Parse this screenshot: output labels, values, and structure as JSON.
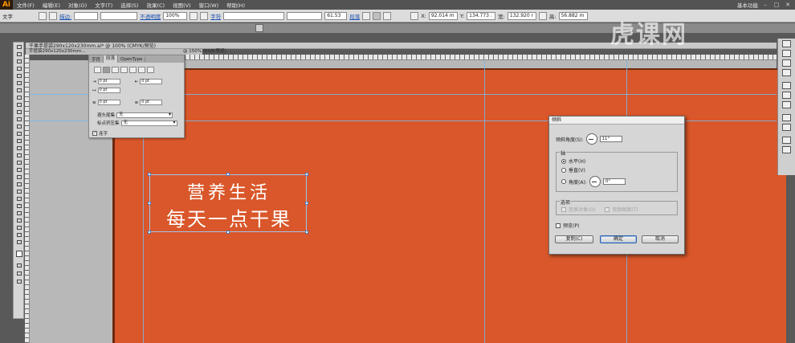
{
  "menubar": {
    "logo": "Ai",
    "items": [
      "文件(F)",
      "编辑(E)",
      "对象(O)",
      "文字(T)",
      "选择(S)",
      "效果(C)",
      "视图(V)",
      "窗口(W)",
      "帮助(H)"
    ],
    "workspace": "基本功能",
    "window_buttons": [
      "–",
      "□",
      "✕"
    ]
  },
  "controlbar": {
    "tool_label": "文字",
    "stroke_label": "描边:",
    "opacity_label": "不透明度",
    "opacity_value": "100%",
    "font_link": "字符",
    "font_size": "61.53",
    "paragraph_link": "段落",
    "x_label": "X:",
    "x_value": "92.014 m",
    "y_label": "Y:",
    "y_value": "134.773 :",
    "w_label": "宽:",
    "w_value": "132.920 r",
    "h_label": "高:",
    "h_value": "56.882 m"
  },
  "doc": {
    "tab1": "干果手提袋290x120x230mm.ai* @ 100% (CMYK/预览)",
    "tab2": "手提袋290x120x230mm...",
    "tab3": "@ 150% (RGB/预览)"
  },
  "char_panel": {
    "tabs": [
      "字符",
      "段落",
      "OpenType"
    ],
    "indent_left": "0 pt",
    "indent_right": "0 pt",
    "first_line": "0 pt",
    "space_before": "0 pt",
    "space_after": "0 pt",
    "kinsoku_label": "避头尾集",
    "kinsoku_value": "无",
    "mojikumi_label": "标点挤压集",
    "mojikumi_value": "无",
    "hyphen_label": "连字"
  },
  "artboard_text": {
    "line1": "营养生活",
    "line2": "每天一点干果"
  },
  "watermark": "虎课网",
  "shear_dialog": {
    "title": "倾斜",
    "angle_label": "倾斜角度(S):",
    "angle_value": "11°",
    "axis_label": "轴",
    "horizontal": "水平(H)",
    "vertical": "垂直(V)",
    "angle_axis": "角度(A):",
    "angle_axis_value": "0°",
    "options_label": "选项",
    "transform_objects": "变换对象(O)",
    "transform_patterns": "变换图案(T)",
    "preview": "预览(P)",
    "copy_button": "复制(C)",
    "ok_button": "确定",
    "cancel_button": "取消"
  },
  "colors": {
    "artboard": "#d9572a",
    "guides": "#7ab6e8"
  }
}
